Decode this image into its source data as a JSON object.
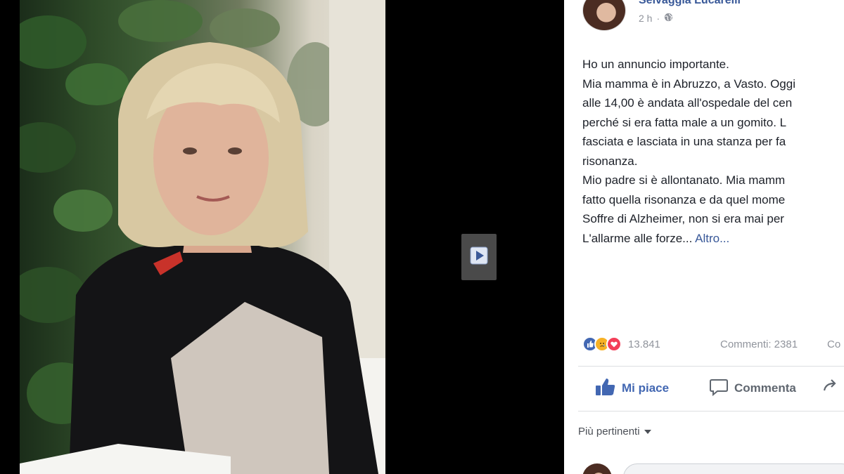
{
  "post": {
    "author": "Selvaggia Lucarelli",
    "time": "2 h",
    "privacy_icon": "globe-icon",
    "lines": [
      "Ho un annuncio importante.",
      "Mia mamma è in Abruzzo, a Vasto. Oggi",
      "alle 14,00 è andata all'ospedale del cen",
      "perché si era fatta male a un gomito. L",
      "fasciata e lasciata in una stanza per fa",
      "risonanza.",
      "Mio padre si è allontanato. Mia mamm",
      "fatto quella risonanza e da quel mome",
      "Soffre di Alzheimer, non si era mai per",
      "L'allarme alle forze... "
    ],
    "more_label": "Altro..."
  },
  "stats": {
    "reaction_count": "13.841",
    "comments": "Commenti: 2381",
    "shares": "Co"
  },
  "actions": {
    "like": "Mi piace",
    "comment": "Commenta"
  },
  "comments_sort": {
    "label": "Più pertinenti"
  },
  "colors": {
    "link": "#385898",
    "like_blue": "#4267b2",
    "love_red": "#f33e58",
    "sad_yellow": "#f7b125",
    "muted": "#90949c"
  }
}
